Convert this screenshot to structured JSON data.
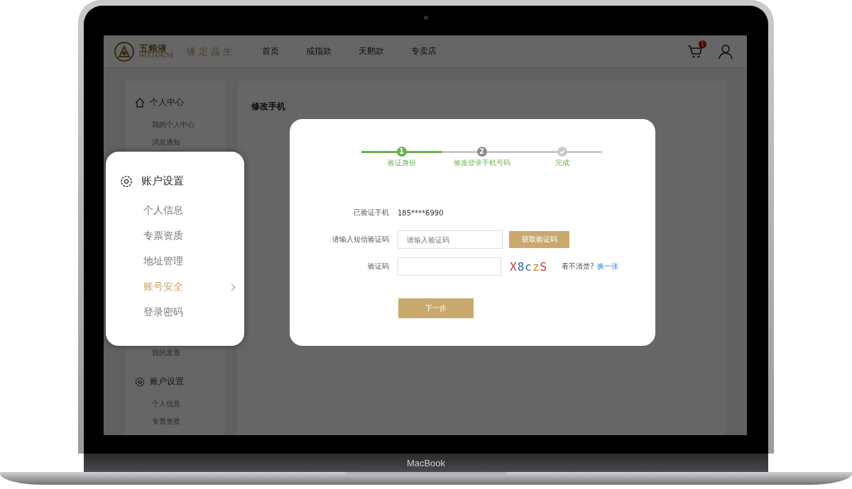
{
  "header": {
    "logo_text": "五粮液",
    "logo_subtext": "WULIANGYE",
    "slogan": "缘定晶生",
    "nav": [
      {
        "label": "首页"
      },
      {
        "label": "戒指款"
      },
      {
        "label": "天鹅款"
      },
      {
        "label": "专卖店"
      }
    ],
    "cart_badge": "1"
  },
  "sidebar": {
    "groups": [
      {
        "kind": "home",
        "title": "个人中心",
        "items": [
          {
            "label": "我的个人中心",
            "gap_before": false
          },
          {
            "label": "消息通知",
            "gap_before": false
          },
          {
            "label": "我的发票",
            "gap_before": true
          }
        ]
      },
      {
        "kind": "gear",
        "title": "账户设置",
        "items": [
          {
            "label": "个人信息",
            "gap_before": false
          },
          {
            "label": "专票资质",
            "gap_before": false
          }
        ]
      }
    ]
  },
  "page_title": "修改手机",
  "popup_menu": {
    "title": "账户设置",
    "items": [
      {
        "label": "个人信息",
        "selected": false
      },
      {
        "label": "专票资质",
        "selected": false
      },
      {
        "label": "地址管理",
        "selected": false
      },
      {
        "label": "账号安全",
        "selected": true
      },
      {
        "label": "登录密码",
        "selected": false
      }
    ]
  },
  "dialog": {
    "steps": [
      {
        "kind": "number",
        "marker": "1",
        "label": "验证身份",
        "active": true
      },
      {
        "kind": "number",
        "marker": "2",
        "label": "修改登录手机号码",
        "active": false
      },
      {
        "kind": "check",
        "label": "完成",
        "active": false
      }
    ],
    "phone_label": "已验证手机",
    "phone_value": "185****6990",
    "sms_label": "请输入短信验证码",
    "sms_placeholder": "请输入验证码",
    "sms_button": "获取验证码",
    "captcha_label": "验证码",
    "captcha_text": "X8czS",
    "captcha_hint": "看不清楚?",
    "captcha_refresh": "换一张",
    "next_button": "下一步"
  },
  "device_label": "MacBook"
}
